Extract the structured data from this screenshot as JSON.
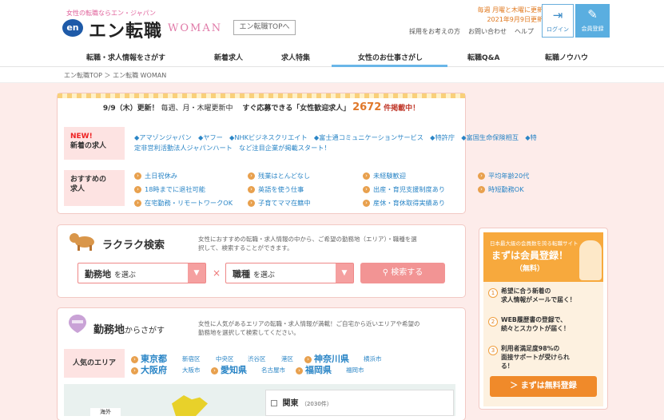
{
  "header": {
    "tagline": "女性の転職ならエン・ジャパン",
    "logo_en": "en",
    "logo_text": "エン転職",
    "logo_woman": "WOMAN",
    "top_link": "エン転職TOPへ",
    "update_line1": "毎週 月曜と木曜に更新",
    "update_line2": "2021年9月9日更新",
    "links": [
      "採用をお考えの方",
      "お問い合わせ",
      "ヘルプ"
    ],
    "login": "ログイン",
    "register": "会員登録"
  },
  "nav": [
    "転職・求人情報をさがす",
    "新着求人",
    "求人特集",
    "女性のお仕事さがし",
    "転職Q&A",
    "転職ノウハウ"
  ],
  "breadcrumb": "エン転職TOP ＞ エン転職 WOMAN",
  "news": {
    "date": "9/9（木）更新！",
    "schedule": "毎週、月・木曜更新中",
    "text1": "すぐ応募できる「女性歓迎求人」",
    "count": "2672",
    "text2": "件掲載中！"
  },
  "new_jobs": {
    "badge": "NEW!",
    "label": "新着の求人",
    "line1": "◆アマゾンジャパン　◆ヤフー　◆NHKビジネスクリエイト　◆富士通コミュニケーションサービス　◆特許庁　◆富国生命保険相互　◆特",
    "line2": "定非営利活動法人ジャパンハート　など注目企業が掲載スタート！"
  },
  "recommend": {
    "label1": "おすすめの",
    "label2": "求人",
    "items": [
      "土日祝休み",
      "残業はとんどなし",
      "未経験歓迎",
      "平均年齢20代",
      "18時までに退社可能",
      "英語を使う仕事",
      "出産・育児支援制度あり",
      "時短勤務OK",
      "在宅勤務・リモートワークOK",
      "子育てママ在籍中",
      "産休・育休取得実績あり"
    ]
  },
  "search": {
    "title": "ラクラク検索",
    "desc1": "女性におすすめの転職・求人情報の中から、ご希望の勤務地（エリア）・職種を選",
    "desc2": "択して、検索することができます。",
    "location_main": "勤務地",
    "location_sub": "を選ぶ",
    "job_main": "職種",
    "job_sub": "を選ぶ",
    "times": "×",
    "button": "検索する"
  },
  "area": {
    "title": "勤務地",
    "title_sub": "からさがす",
    "desc1": "女性に人気があるエリアの転職・求人情報が満載！ご自宅から近いエリアや希望の",
    "desc2": "勤務地を選択して検索してください。",
    "popular_label": "人気のエリア",
    "row1": {
      "pref1": "東京都",
      "cities1": [
        "新宿区",
        "中央区",
        "渋谷区",
        "港区"
      ],
      "pref2": "神奈川県",
      "cities2": [
        "横浜市"
      ]
    },
    "row2": {
      "pref1": "大阪府",
      "cities1": [
        "大阪市"
      ],
      "pref2": "愛知県",
      "cities2": [
        "名古屋市"
      ],
      "pref3": "福岡県",
      "cities3": [
        "福岡市"
      ]
    },
    "overseas": "海外",
    "kanto": "関東",
    "kanto_count": "（2030件）"
  },
  "sidebar": {
    "small": "日本最大級の会員数を誇る転職サイト",
    "title": "まずは会員登録！",
    "free": "（無料）",
    "benefits": [
      [
        "希望に合う新着の",
        "求人情報がメールで届く！"
      ],
      [
        "WEB履歴書の登録で、",
        "続々とスカウトが届く！"
      ],
      [
        "利用者満足度98%の",
        "面接サポートが受けられ",
        "る！"
      ]
    ],
    "button": "＞ まずは無料登録"
  }
}
